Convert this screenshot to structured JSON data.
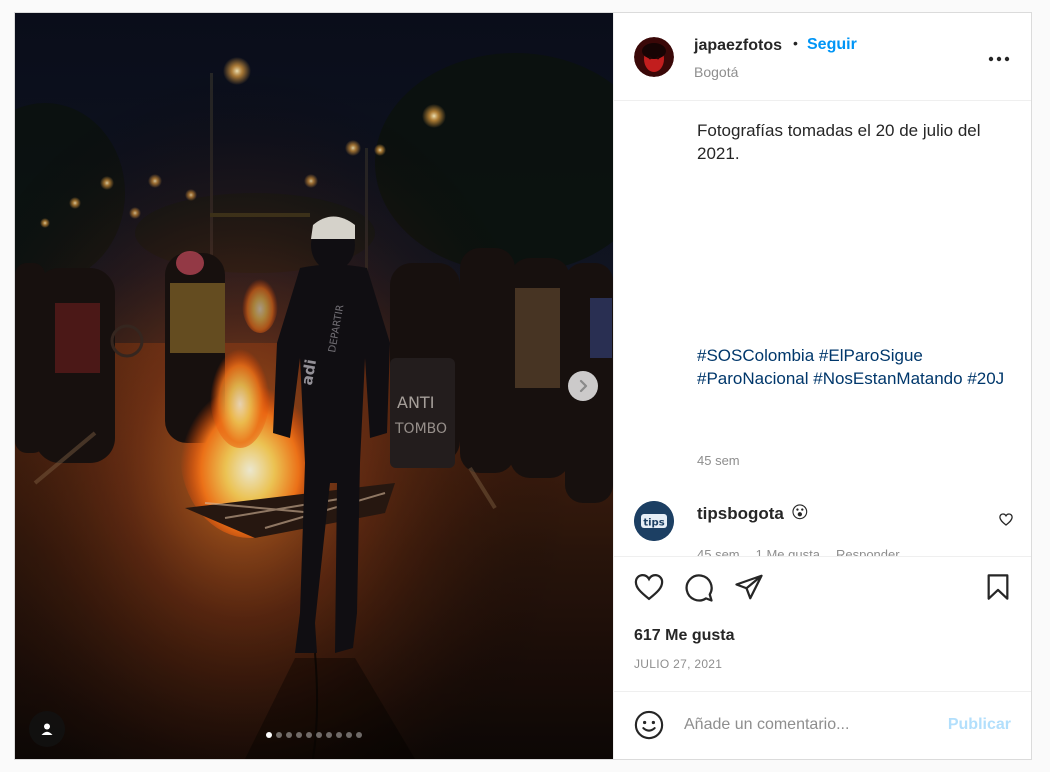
{
  "post": {
    "author": {
      "username": "japaezfotos",
      "separator": "•",
      "follow_label": "Seguir",
      "location": "Bogotá"
    },
    "caption": "Fotografías tomadas el 20 de julio del 2021.",
    "hashtags": [
      "#SOSColombia",
      "#ElParoSigue",
      "#ParoNacional",
      "#NosEstanMatando",
      "#20J"
    ],
    "caption_time": "45 sem",
    "carousel": {
      "total_slides": 10,
      "current_slide": 1
    },
    "comment": {
      "username": "tipsbogota",
      "emoji": "😮",
      "avatar_text": "tips",
      "time": "45 sem",
      "likes": "1 Me gusta",
      "reply_label": "Responder"
    },
    "likes_text": "617 Me gusta",
    "date": "JULIO 27, 2021",
    "add_comment": {
      "placeholder": "Añade un comentario...",
      "publish_label": "Publicar"
    },
    "icons": {
      "like": "heart-icon",
      "comment": "comment-bubble-icon",
      "share": "paper-plane-icon",
      "save": "bookmark-icon",
      "emoji": "smiley-icon",
      "more": "more-horizontal-icon",
      "next": "chevron-right-icon",
      "tags": "user-icon"
    },
    "colors": {
      "accent": "#0095f6",
      "hashtag": "#00376b",
      "muted": "#8e8e8e",
      "publish_disabled": "#b2dffc"
    }
  }
}
